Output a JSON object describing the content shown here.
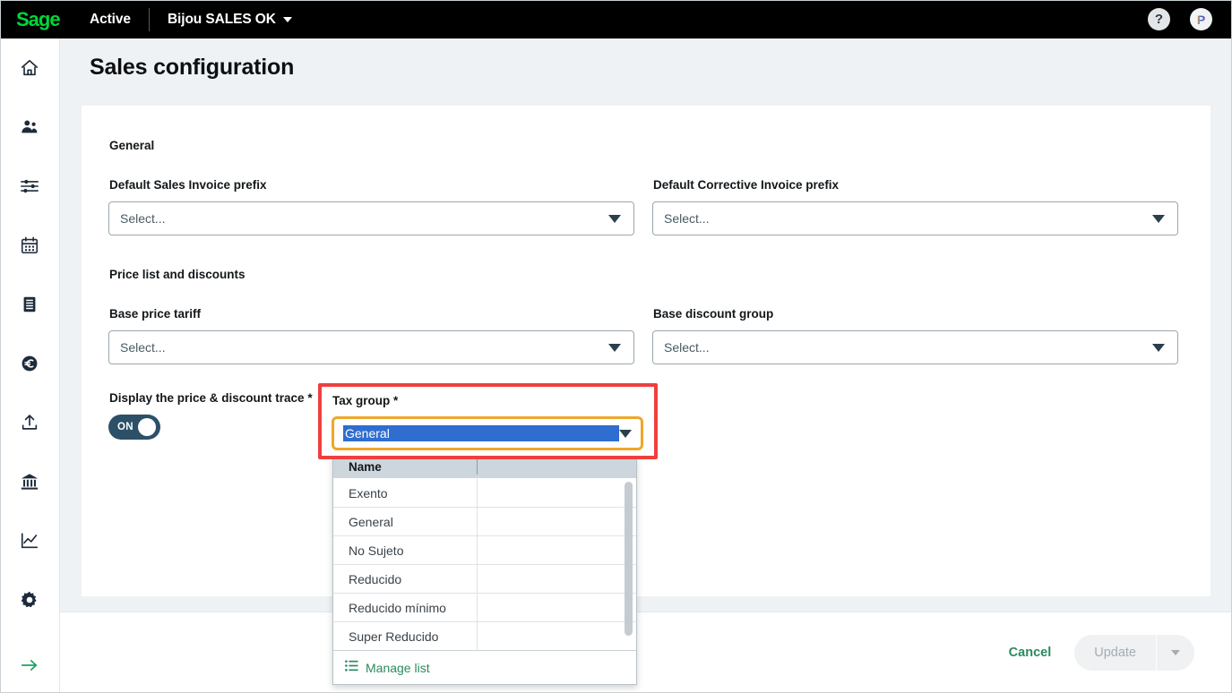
{
  "topbar": {
    "logo": "Sage",
    "app_name": "Active",
    "company": "Bijou SALES OK",
    "company_caret_icon": "chevron-down-icon",
    "help_label": "?",
    "avatar_initial": "P"
  },
  "sidebar": {
    "items": [
      {
        "icon": "home-icon",
        "name": "home"
      },
      {
        "icon": "people-icon",
        "name": "contacts"
      },
      {
        "icon": "sliders-icon",
        "name": "settings-sliders"
      },
      {
        "icon": "calendar-icon",
        "name": "calendar"
      },
      {
        "icon": "document-icon",
        "name": "documents"
      },
      {
        "icon": "currency-euro-icon",
        "name": "payments"
      },
      {
        "icon": "upload-icon",
        "name": "upload"
      },
      {
        "icon": "bank-icon",
        "name": "banking"
      },
      {
        "icon": "chart-line-icon",
        "name": "reports"
      },
      {
        "icon": "gear-icon",
        "name": "configuration"
      }
    ],
    "expand": {
      "icon": "arrow-right-icon",
      "name": "expand-sidebar"
    }
  },
  "page": {
    "title": "Sales configuration"
  },
  "form": {
    "sections": [
      {
        "title": "General"
      },
      {
        "title": "Price list and discounts"
      }
    ],
    "fields": {
      "default_sales_invoice_prefix": {
        "label": "Default Sales Invoice prefix",
        "value": "",
        "placeholder": "Select..."
      },
      "default_corrective_invoice_prefix": {
        "label": "Default Corrective Invoice prefix",
        "value": "",
        "placeholder": "Select..."
      },
      "base_price_tariff": {
        "label": "Base price tariff",
        "value": "",
        "placeholder": "Select..."
      },
      "base_discount_group": {
        "label": "Base discount group",
        "value": "",
        "placeholder": "Select..."
      },
      "display_price_discount_trace": {
        "label": "Display the price & discount trace *",
        "toggle_state": "ON"
      },
      "tax_group": {
        "label": "Tax group *",
        "value": "General",
        "selected_text_highlighted": true
      }
    }
  },
  "dropdown": {
    "column_header": "Name",
    "options": [
      "Exento",
      "General",
      "No Sujeto",
      "Reducido",
      "Reducido mínimo",
      "Super Reducido"
    ],
    "footer": {
      "label": "Manage list",
      "icon": "list-icon"
    }
  },
  "footer": {
    "cancel_label": "Cancel",
    "update_label": "Update",
    "update_caret_icon": "chevron-down-icon",
    "update_disabled": true
  },
  "colors": {
    "brand_green": "#2a8a5f",
    "sage_logo_green": "#00d639",
    "topbar_black": "#000000",
    "page_background": "#eff2f4",
    "card_white": "#ffffff",
    "highlight_red": "#ef3f3f",
    "focus_orange": "#f0a62a",
    "selection_blue": "#2f6dd0",
    "toggle_on": "#2b5068",
    "dropdown_header": "#ccd6dc"
  }
}
